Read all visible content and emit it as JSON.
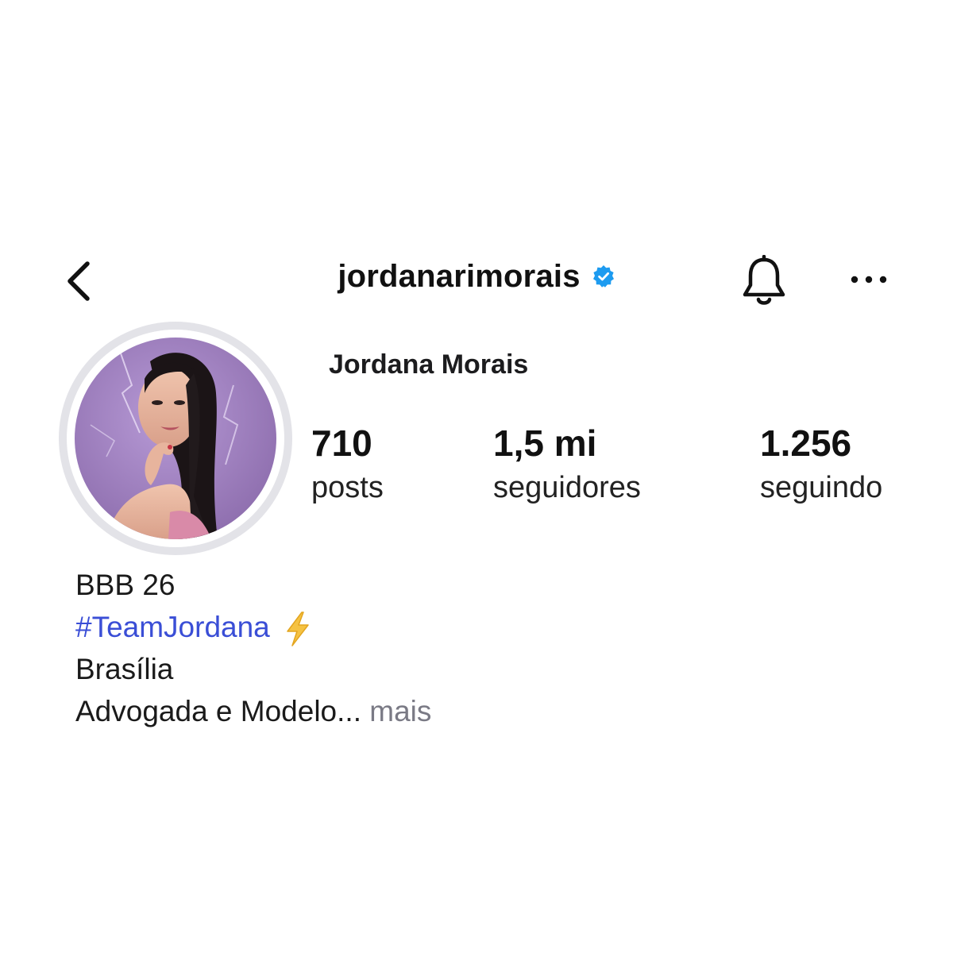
{
  "header": {
    "username": "jordanarimorais",
    "verified": true,
    "icons": {
      "back": "chevron-left-icon",
      "verified": "verified-badge-icon",
      "bell": "bell-icon",
      "more": "more-horizontal-icon"
    }
  },
  "profile": {
    "display_name": "Jordana Morais",
    "avatar": "profile-photo"
  },
  "stats": [
    {
      "value": "710",
      "label": "posts"
    },
    {
      "value": "1,5 mi",
      "label": "seguidores"
    },
    {
      "value": "1.256",
      "label": "seguindo"
    }
  ],
  "bio": {
    "line1": "BBB 26",
    "hashtag": "#TeamJordana",
    "hashtag_emoji": "lightning-bolt-icon",
    "line3": "Brasília",
    "line4": "Advogada e Modelo...",
    "more_label": "mais"
  },
  "colors": {
    "text": "#111111",
    "link": "#3a4ed6",
    "muted": "#7a7a85",
    "verified": "#1d9bf0",
    "avatar_ring": "#e3e3e8"
  }
}
